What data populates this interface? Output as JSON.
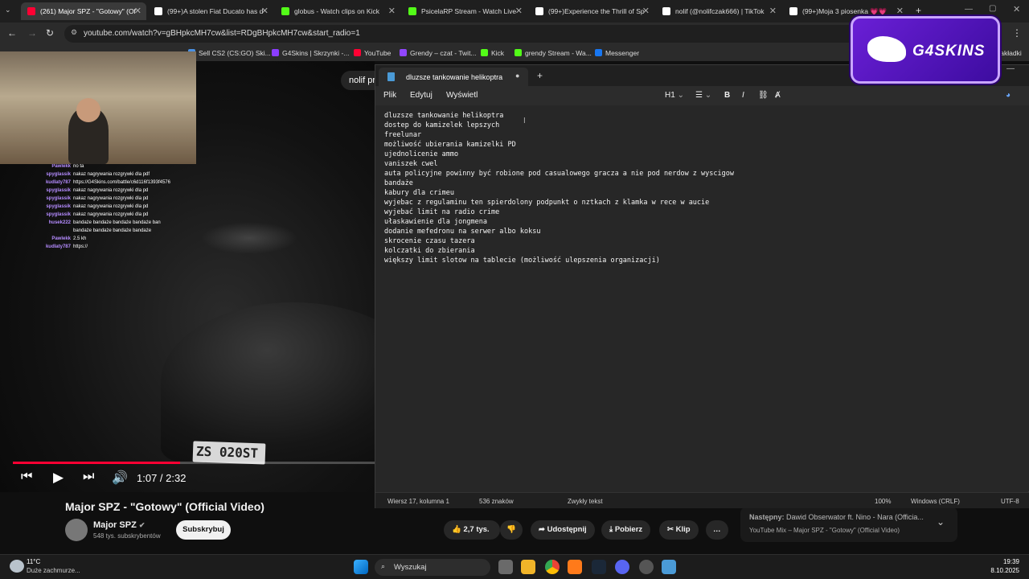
{
  "browser": {
    "tabs": [
      {
        "label": "(261) Major SPZ - \"Gotowy\" (Of",
        "favicon": "youtube-icon",
        "color": "#ff0033",
        "active": true
      },
      {
        "label": "(99+)A stolen Fiat Ducato has d",
        "favicon": "tiktok-icon",
        "color": "#ffffff",
        "active": false
      },
      {
        "label": "globus - Watch clips on Kick",
        "favicon": "kick-icon",
        "color": "#53fc18",
        "active": false
      },
      {
        "label": "PsicelaRP Stream - Watch Live",
        "favicon": "kick-icon",
        "color": "#53fc18",
        "active": false
      },
      {
        "label": "(99+)Experience the Thrill of Sp",
        "favicon": "tiktok-icon",
        "color": "#ffffff",
        "active": false
      },
      {
        "label": "nolif (@nolifczak666) | TikTok",
        "favicon": "tiktok-icon",
        "color": "#ffffff",
        "active": false
      },
      {
        "label": "(99+)Moja 3 piosenka 💗💗",
        "favicon": "tiktok-icon",
        "color": "#ffffff",
        "active": false
      }
    ],
    "url": "youtube.com/watch?v=gBHpkcMH7cw&list=RDgBHpkcMH7cw&start_radio=1",
    "bookmarks": [
      {
        "label": "Sell CS2 (CS:GO) Ski...",
        "color": "#4a90e2"
      },
      {
        "label": "G4Skins | Skrzynki -...",
        "color": "#8b3dff"
      },
      {
        "label": "YouTube",
        "color": "#ff0033"
      },
      {
        "label": "Grendy – czat - Twit...",
        "color": "#9146ff"
      },
      {
        "label": "Kick",
        "color": "#53fc18"
      },
      {
        "label": "grendy Stream - Wa...",
        "color": "#53fc18"
      },
      {
        "label": "Messenger",
        "color": "#1877f2"
      }
    ],
    "bookmarks_right": "zakładki"
  },
  "video": {
    "plate": "ZS 020ST",
    "overlay_pill": "nolif pr",
    "time": "1:07 / 2:32",
    "progress": 0.4612,
    "chat": [
      {
        "user": "Pawlekk",
        "msg": "no ta"
      },
      {
        "user": "spyglassik",
        "msg": "nakaz nagrywania rozgrywki dla pdf"
      },
      {
        "user": "kudlaty787",
        "msg": "https://G4Skins.com/battle/c6d116f1393f4576"
      },
      {
        "user": "spyglassik",
        "msg": "nakaz nagrywania rozgrywki dla pd"
      },
      {
        "user": "spyglassik",
        "msg": "nakaz nagrywania rozgrywki dla pd"
      },
      {
        "user": "spyglassik",
        "msg": "nakaz nagrywania rozgrywki dla pd"
      },
      {
        "user": "spyglassik",
        "msg": "nakaz nagrywania rozgrywki dla pd"
      },
      {
        "user": "husek222",
        "msg": "bandaże bandaże bandaże bandaże ban"
      },
      {
        "user": "",
        "msg": "bandaże bandaże bandaże bandaże"
      },
      {
        "user": "Pawlekk",
        "msg": "2.5 kh"
      },
      {
        "user": "kudlaty787",
        "msg": "https://"
      }
    ]
  },
  "youtube": {
    "title": "Major SPZ - \"Gotowy\" (Official Video)",
    "channel": "Major SPZ",
    "subscribers": "548 tys. subskrybentów",
    "subscribe_label": "Subskrybuj",
    "likes": "2,7 tys.",
    "share_label": "Udostępnij",
    "download_label": "Pobierz",
    "clip_label": "Klip",
    "next_label": "Następny:",
    "next_title": "Dawid Obserwator ft. Nino - Nara (Officia...",
    "next_sub": "YouTube Mix – Major SPZ - \"Gotowy\" (Official Video)"
  },
  "notepad": {
    "tab_title": "dluzsze tankowanie helikoptra",
    "menu": [
      "Plik",
      "Edytuj",
      "Wyświetl"
    ],
    "heading_label": "H1",
    "lines": [
      "dluzsze tankowanie helikoptra",
      "dostep do kamizelek lepszych",
      "freelunar",
      "możliwość ubierania kamizelki PD",
      "ujednolicenie ammo",
      "vaniszek cwel",
      "auta policyjne powinny być robione pod casualowego gracza a nie pod nerdow z wyscigow",
      "bandaże",
      "kabury dla crimeu",
      "wyjebac z regulaminu ten spierdolony podpunkt o nztkach z klamka w rece w aucie",
      "wyjebać limit na radio crime",
      "ułaskawienie dla jongmena",
      "dodanie mefedronu na serwer albo koksu",
      "skrocenie czasu tazera",
      "kolczatki do zbierania",
      "większy limit slotow na tablecie (możliwość ulepszenia organizacji)"
    ],
    "status": {
      "position": "Wiersz 17, kolumna 1",
      "chars": "536 znaków",
      "format": "Zwykły tekst",
      "zoom": "100%",
      "eol": "Windows (CRLF)",
      "encoding": "UTF-8"
    }
  },
  "overlay_logo": "G4SKINS",
  "taskbar": {
    "temperature": "11°C",
    "weather": "Duże zachmurze...",
    "search_label": "Wyszukaj",
    "time": "19:39",
    "date": "8.10.2025"
  }
}
